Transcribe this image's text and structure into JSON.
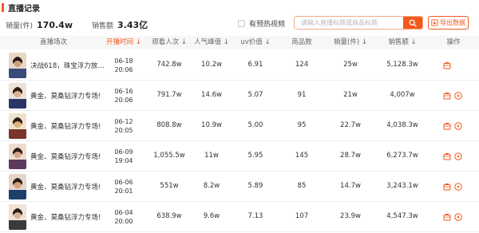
{
  "header": {
    "title": "直播记录"
  },
  "summary": {
    "sales_count_label": "销量(件)",
    "sales_count_value": "170.4w",
    "sales_amount_label": "销售额",
    "sales_amount_value": "3.43亿"
  },
  "filters": {
    "warmup_label": "有预热视频",
    "search_placeholder": "请输入直播标题或商品标题",
    "export_label": "导出数据"
  },
  "colors": {
    "accent": "#f5581e",
    "header_bg": "#f7f7f7"
  },
  "table": {
    "columns": [
      "直播场次",
      "开播时间",
      "观看人次",
      "人气峰值",
      "uv价值",
      "商品数",
      "销量(件)",
      "销售额",
      "操作"
    ],
    "sorted_column": "开播时间",
    "rows": [
      {
        "title": "决战618，珠宝浮力放…",
        "date": "06-18",
        "time": "20:06",
        "viewers": "742.8w",
        "peak": "10.2w",
        "uv": "6.91",
        "goods": "124",
        "sales": "25w",
        "amount": "5,128.3w",
        "has_play": false
      },
      {
        "title": "黄金、莫桑钻浮力专场!",
        "date": "06-16",
        "time": "20:06",
        "viewers": "791.7w",
        "peak": "14.6w",
        "uv": "5.07",
        "goods": "91",
        "sales": "21w",
        "amount": "4,007w",
        "has_play": true
      },
      {
        "title": "黄金、莫桑钻浮力专场!",
        "date": "06-12",
        "time": "20:05",
        "viewers": "808.8w",
        "peak": "10.9w",
        "uv": "5.00",
        "goods": "95",
        "sales": "22.7w",
        "amount": "4,038.3w",
        "has_play": true
      },
      {
        "title": "黄金、莫桑钻浮力专场!",
        "date": "06-09",
        "time": "19:04",
        "viewers": "1,055.5w",
        "peak": "11w",
        "uv": "5.95",
        "goods": "145",
        "sales": "28.7w",
        "amount": "6,273.7w",
        "has_play": true
      },
      {
        "title": "黄金、莫桑钻浮力专场!",
        "date": "06-06",
        "time": "20:01",
        "viewers": "551w",
        "peak": "8.2w",
        "uv": "5.89",
        "goods": "85",
        "sales": "14.7w",
        "amount": "3,243.1w",
        "has_play": true
      },
      {
        "title": "黄金、莫桑钻浮力专场!",
        "date": "06-04",
        "time": "20:00",
        "viewers": "638.9w",
        "peak": "9.6w",
        "uv": "7.13",
        "goods": "107",
        "sales": "23.9w",
        "amount": "4,547.3w",
        "has_play": true
      }
    ]
  },
  "icons": {
    "search": "search-icon",
    "export": "export-icon",
    "product": "product-icon",
    "play": "play-icon"
  }
}
